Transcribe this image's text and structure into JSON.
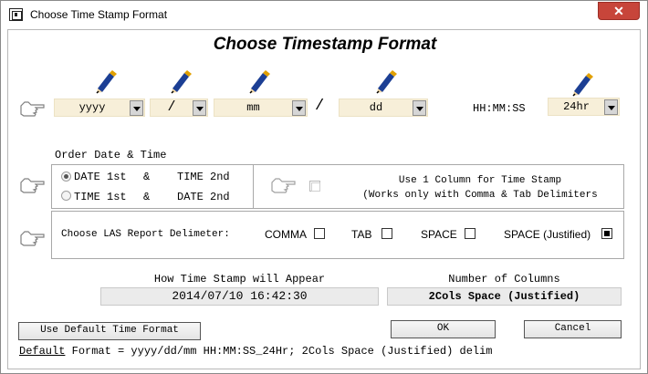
{
  "window": {
    "title": "Choose Time Stamp Format",
    "close_glyph": "✕"
  },
  "heading": "Choose Timestamp Format",
  "format_row": {
    "year": "yyyy",
    "separator1": "/",
    "month": "mm",
    "separator_static": "/",
    "day": "dd",
    "time_label": "HH:MM:SS",
    "hour_format": "24hr"
  },
  "order": {
    "label": "Order Date & Time",
    "option1": {
      "date": "DATE 1st",
      "amp": "&",
      "time": "TIME 2nd",
      "selected": true
    },
    "option2": {
      "time": "TIME 1st",
      "amp": "&",
      "date": "DATE 2nd",
      "selected": false
    },
    "one_column_line1": "Use 1 Column for Time Stamp",
    "one_column_line2": "(Works only with Comma & Tab Delimiters",
    "one_column_checked": false
  },
  "delimiter": {
    "label": "Choose LAS Report Delimeter:",
    "options": [
      {
        "label": "COMMA",
        "checked": false
      },
      {
        "label": "TAB",
        "checked": false
      },
      {
        "label": "SPACE",
        "checked": false
      },
      {
        "label": "SPACE (Justified)",
        "checked": true
      }
    ]
  },
  "preview": {
    "label": "How Time Stamp will Appear",
    "value": "2014/07/10 16:42:30",
    "columns_label": "Number of Columns",
    "columns_value": "2Cols Space (Justified)"
  },
  "buttons": {
    "default_format": "Use Default Time Format",
    "ok": "OK",
    "cancel": "Cancel"
  },
  "footer": {
    "default_word": "Default",
    "rest": " Format = yyyy/dd/mm HH:MM:SS_24Hr; 2Cols Space (Justified) delim"
  },
  "colors": {
    "combo_bg": "#f7efd9",
    "close_red": "#c7453a",
    "pencil_blue": "#1c3f94",
    "pencil_gold": "#e1a000"
  },
  "icons": [
    "app-icon",
    "close-icon",
    "pencil-icon",
    "pointing-hand-icon",
    "dropdown-arrow-icon"
  ]
}
